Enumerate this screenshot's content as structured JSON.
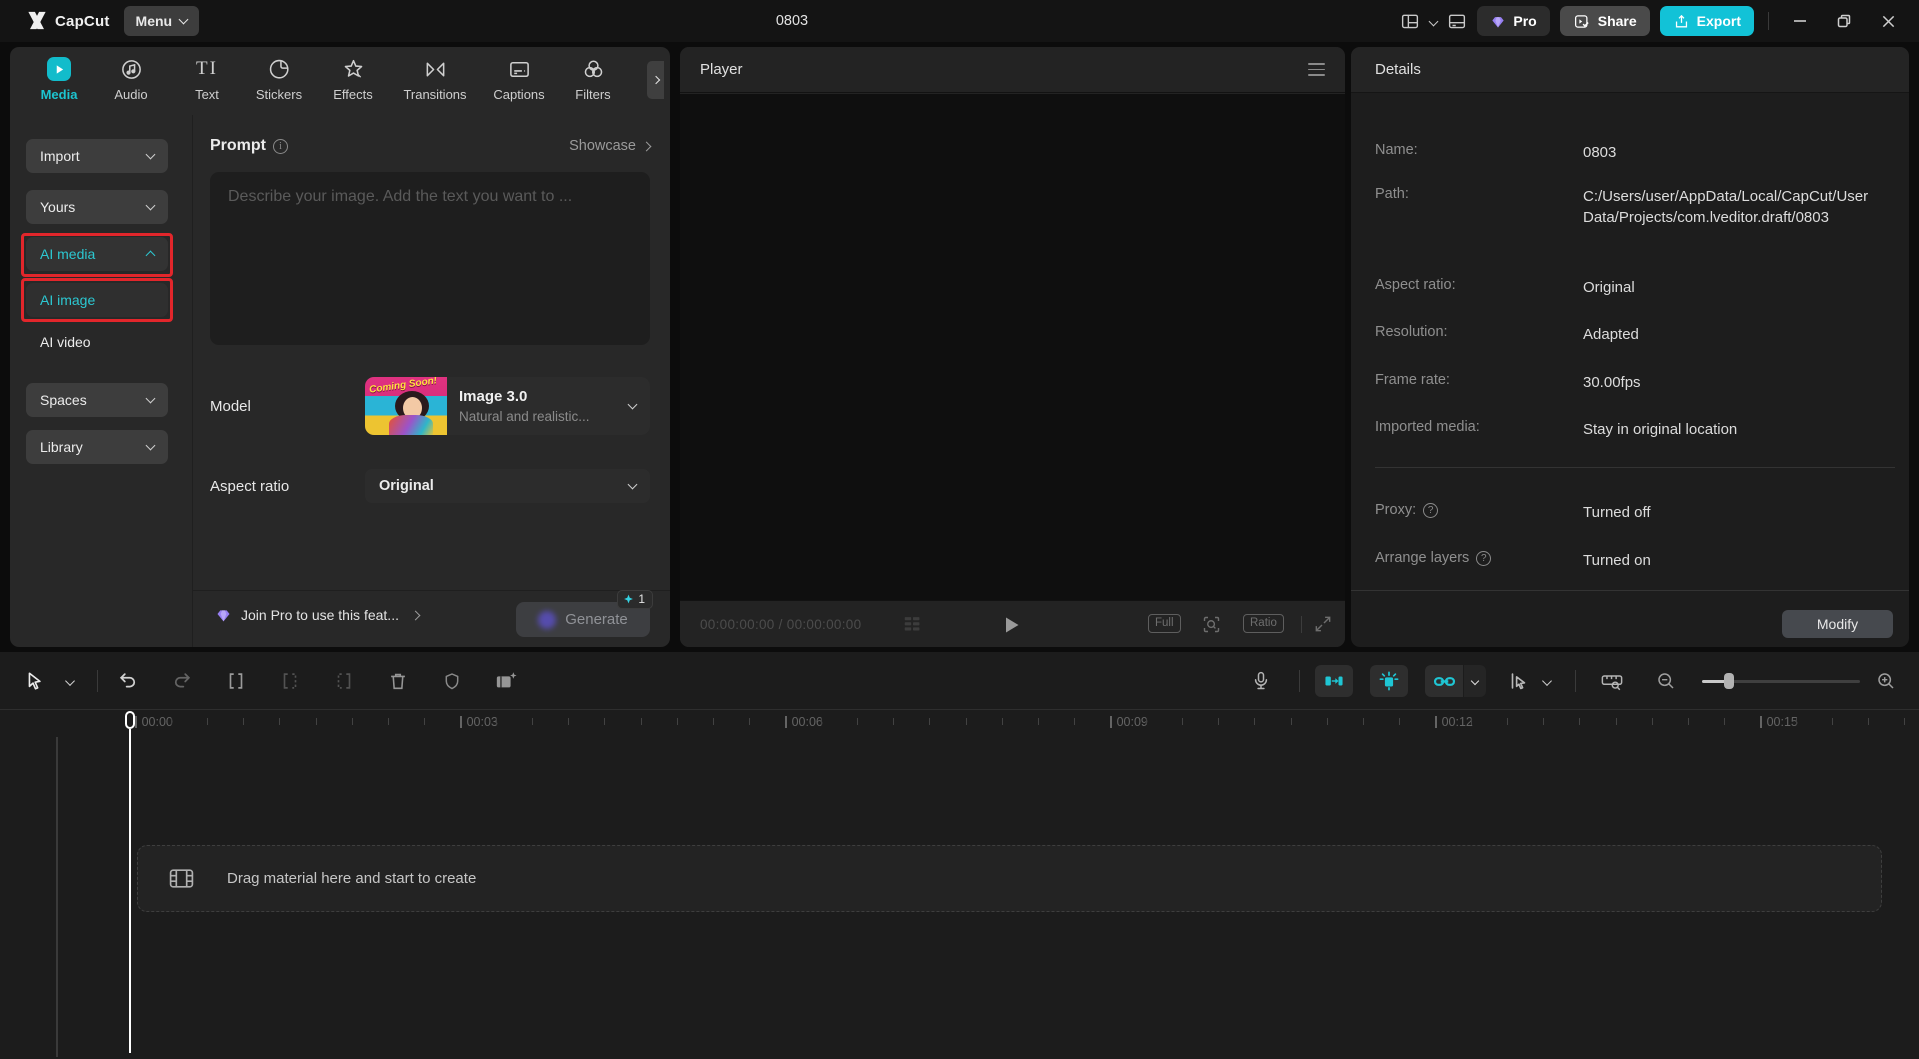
{
  "titlebar": {
    "app_name": "CapCut",
    "menu_label": "Menu",
    "project_title": "0803",
    "pro_label": "Pro",
    "share_label": "Share",
    "export_label": "Export"
  },
  "tabs": [
    {
      "label": "Media"
    },
    {
      "label": "Audio"
    },
    {
      "label": "Text"
    },
    {
      "label": "Stickers"
    },
    {
      "label": "Effects"
    },
    {
      "label": "Transitions"
    },
    {
      "label": "Captions"
    },
    {
      "label": "Filters"
    }
  ],
  "sidebar": {
    "items": [
      {
        "label": "Import"
      },
      {
        "label": "Yours"
      },
      {
        "label": "AI media"
      },
      {
        "label": "AI image"
      },
      {
        "label": "AI video"
      },
      {
        "label": "Spaces"
      },
      {
        "label": "Library"
      }
    ]
  },
  "prompt": {
    "title": "Prompt",
    "showcase_label": "Showcase",
    "placeholder": "Describe your image. Add the text you want to ...",
    "model_label": "Model",
    "model_badge": "Coming Soon!",
    "model_name": "Image 3.0",
    "model_desc": "Natural and realistic...",
    "aspect_label": "Aspect ratio",
    "aspect_value": "Original",
    "join_pro_label": "Join Pro to use this feat...",
    "generate_label": "Generate",
    "credit_count": "1"
  },
  "player": {
    "title": "Player",
    "time_display": "00:00:00:00 / 00:00:00:00",
    "full_label": "Full",
    "ratio_label": "Ratio"
  },
  "details": {
    "title": "Details",
    "rows": [
      {
        "label": "Name:",
        "value": "0803"
      },
      {
        "label": "Path:",
        "value": "C:/Users/user/AppData/Local/CapCut/User Data/Projects/com.lveditor.draft/0803"
      },
      {
        "label": "Aspect ratio:",
        "value": "Original"
      },
      {
        "label": "Resolution:",
        "value": "Adapted"
      },
      {
        "label": "Frame rate:",
        "value": "30.00fps"
      },
      {
        "label": "Imported media:",
        "value": "Stay in original location"
      }
    ],
    "toggles": [
      {
        "label": "Proxy:",
        "value": "Turned off"
      },
      {
        "label": "Arrange layers",
        "value": "Turned on"
      }
    ],
    "modify_label": "Modify"
  },
  "timeline": {
    "ruler_labels": [
      "00:00",
      "00:03",
      "00:06",
      "00:09",
      "00:12",
      "00:15"
    ],
    "drag_hint": "Drag material here and start to create"
  },
  "colors": {
    "accent_cyan": "#12c2d7",
    "highlight_red": "#e2262b",
    "pro_gem_purple": "#977ff2"
  }
}
